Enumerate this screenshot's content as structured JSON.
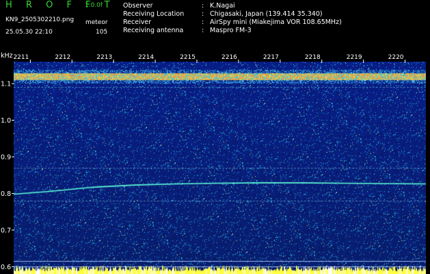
{
  "header": {
    "app_title": "H R O F F T",
    "app_version": "1.0.0f",
    "file_name": "KN9_2505302210.png",
    "timestamp": "25.05.30 22:10",
    "meteor_label": "meteor",
    "meteor_count": "105",
    "meta": [
      {
        "key": "Observer",
        "value": "K.Nagai"
      },
      {
        "key": "Receiving Location",
        "value": "Chigasaki, Japan (139.414 35.340)"
      },
      {
        "key": "Receiver",
        "value": "AirSpy mini (Miakejima VOR 108.65MHz)"
      },
      {
        "key": "Receiving antenna",
        "value": "Maspro FM-3"
      }
    ]
  },
  "colors": {
    "background": "#000000",
    "text": "#ffffff",
    "title_green": "#35d832",
    "spectrogram_base": "#0a1a8c",
    "trail": "#5fffd8",
    "baseline_noise": "#ffff40"
  },
  "chart_data": {
    "type": "heatmap",
    "y_unit_label": "kHz",
    "y_ticks": [
      "1.1",
      "1.0",
      "0.9",
      "0.8",
      "0.7",
      "0.6"
    ],
    "y_range": [
      0.58,
      1.16
    ],
    "x_ticks": [
      "2211",
      "2212",
      "2213",
      "2214",
      "2215",
      "2216",
      "2217",
      "2218",
      "2219",
      "2220"
    ],
    "x_range": [
      2210.6,
      2220.5
    ],
    "bright_bands_khz": [
      1.12
    ],
    "horizontal_lines_khz": [
      1.09,
      0.87,
      0.78,
      0.615,
      0.6
    ],
    "trail": {
      "x": [
        2210.6,
        2211.5,
        2212.5,
        2213.5,
        2214.5,
        2215.5,
        2216.5,
        2217.5,
        2218.5,
        2219.5,
        2220.5
      ],
      "y": [
        0.798,
        0.806,
        0.817,
        0.823,
        0.826,
        0.828,
        0.829,
        0.829,
        0.828,
        0.827,
        0.826
      ]
    }
  }
}
